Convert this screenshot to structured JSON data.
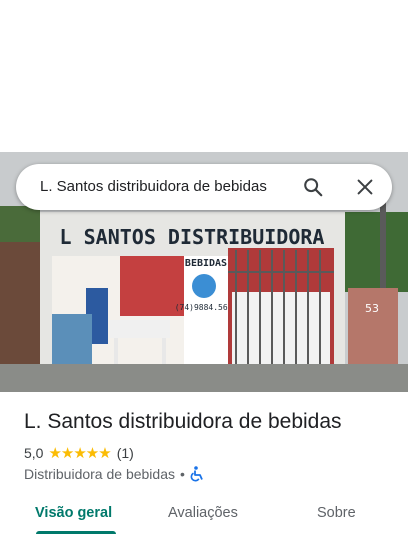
{
  "search": {
    "query": "L. Santos distribuidora de bebidas"
  },
  "photo": {
    "sign_text": "L SANTOS DISTRIBUIDORA",
    "bebidas_text": "BEBIDAS",
    "phone_text": "(74)9884.5664",
    "house_number": "53"
  },
  "place": {
    "name": "L. Santos distribuidora de bebidas",
    "rating": "5,0",
    "stars": "★★★★★",
    "review_count": "(1)",
    "category": "Distribuidora de bebidas",
    "separator": "•"
  },
  "tabs": [
    {
      "label": "Visão geral",
      "active": true
    },
    {
      "label": "Avaliações",
      "active": false
    },
    {
      "label": "Sobre",
      "active": false
    }
  ],
  "colors": {
    "accent": "#00796b",
    "star": "#fbbc04",
    "accessible_icon": "#1a73e8"
  }
}
